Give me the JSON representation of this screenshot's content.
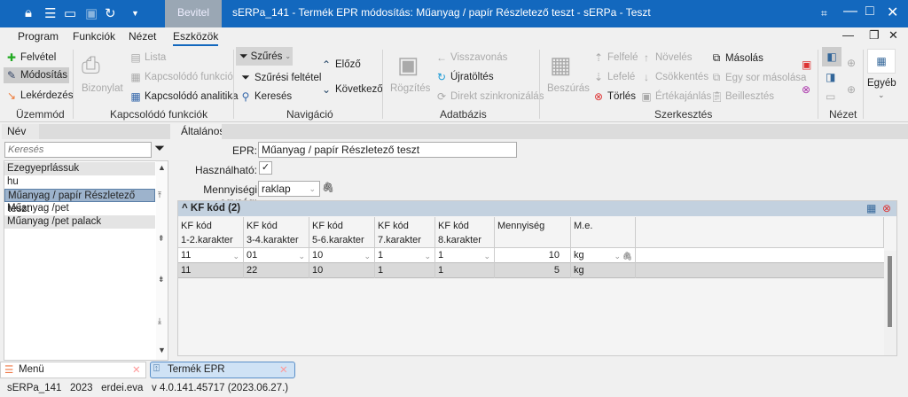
{
  "titlebar": {
    "bevitel": "Bevitel",
    "title": "sERPa_141 - Termék EPR módosítás: Műanyag / papír Részletező teszt - sERPa - Teszt"
  },
  "menu": [
    "Program",
    "Funkciók",
    "Nézet",
    "Eszközök"
  ],
  "ribbon": {
    "uzemmod": {
      "label": "Üzemmód",
      "items": [
        "Felvétel",
        "Módosítás",
        "Lekérdezés"
      ]
    },
    "kapcsolodo": {
      "label": "Kapcsolódó funkciók",
      "bizonylat": "Bizonylat",
      "items": [
        "Lista",
        "Kapcsolódó funkció",
        "Kapcsolódó analitika"
      ]
    },
    "navigacio": {
      "label": "Navigáció",
      "szures": "Szűrés",
      "szuresi": "Szűrési feltétel",
      "kereses": "Keresés",
      "elozo": "Előző",
      "kovetkezo": "Következő"
    },
    "adatbazis": {
      "label": "Adatbázis",
      "rogzites": "Rögzítés",
      "items": [
        "Visszavonás",
        "Újratöltés",
        "Direkt szinkronizálás"
      ]
    },
    "szerkesztes": {
      "label": "Szerkesztés",
      "beszuras": "Beszúrás",
      "col1": [
        "Felfelé",
        "Lefelé",
        "Törlés"
      ],
      "col2": [
        "Növelés",
        "Csökkentés",
        "Értékajánlás"
      ],
      "col3": [
        "Másolás",
        "Egy sor másolása",
        "Beillesztés"
      ]
    },
    "nezet": {
      "label": "Nézet"
    },
    "egyeb": "Egyéb"
  },
  "left": {
    "tab": "Név",
    "search_placeholder": "Keresés",
    "items": [
      "Ezegyeprlássuk",
      "hu",
      "Műanyag / papír Részletező teszt",
      "Műanyag /pet",
      "Műanyag /pet palack"
    ],
    "selected": 2
  },
  "form": {
    "tab": "Általános",
    "epr_label": "EPR:",
    "epr_value": "Műanyag / papír Részletező teszt",
    "hasznalhato_label": "Használható:",
    "hasznalhato_checked": true,
    "check": "✓",
    "me_label": "Mennyiségi egység:",
    "me_value": "raklap"
  },
  "grid": {
    "title": "^ KF kód (2)",
    "headers": [
      [
        "KF kód",
        "1-2.karakter"
      ],
      [
        "KF kód",
        "3-4.karakter"
      ],
      [
        "KF kód",
        "5-6.karakter"
      ],
      [
        "KF kód",
        "7.karakter"
      ],
      [
        "KF kód",
        "8.karakter"
      ],
      [
        "Mennyiség",
        ""
      ],
      [
        "M.e.",
        ""
      ]
    ],
    "rows": [
      [
        "11",
        "01",
        "10",
        "1",
        "1",
        "10",
        "kg"
      ],
      [
        "11",
        "22",
        "10",
        "1",
        "1",
        "5",
        "kg"
      ]
    ]
  },
  "bottom_tabs": [
    "Menü",
    "Termék EPR"
  ],
  "status": "sERPa_141   2023   erdei.eva   v 4.0.141.45717 (2023.06.27.)"
}
